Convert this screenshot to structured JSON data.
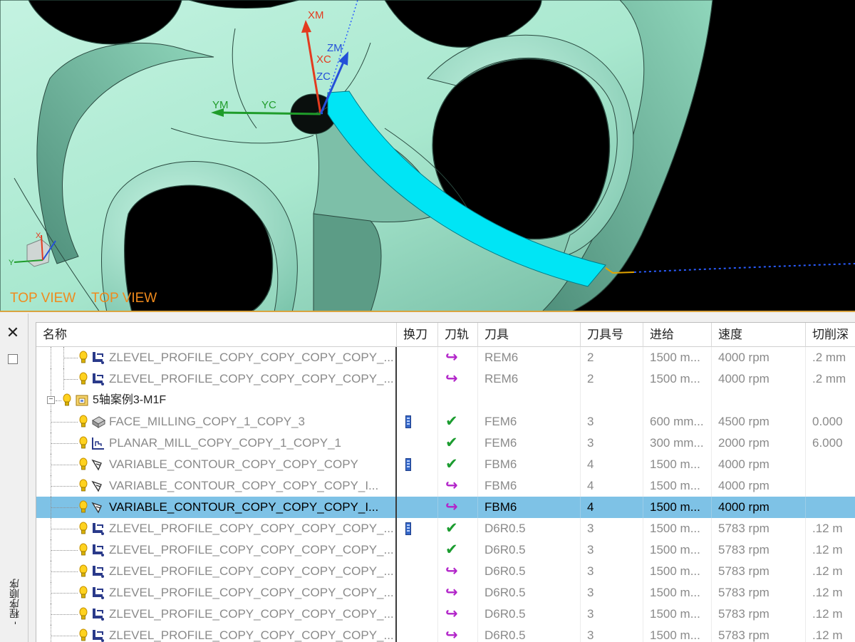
{
  "viewport": {
    "view_labels": [
      "TOP VIEW",
      "TOP VIEW"
    ],
    "axes": {
      "xm": "XM",
      "xc": "XC",
      "zm": "ZM",
      "zc": "ZC",
      "ym": "YM",
      "yc": "YC"
    },
    "triad": {
      "x": "X",
      "y": "Y"
    },
    "colors": {
      "part": "#a9e8cf",
      "highlight": "#00e5f5",
      "background": "#000000",
      "label": "#f08a1c"
    }
  },
  "navigator": {
    "side_label": "- 程序顺序",
    "columns": [
      "名称",
      "换刀",
      "刀轨",
      "刀具",
      "刀具号",
      "进给",
      "速度",
      "切削深"
    ],
    "rows": [
      {
        "indent": 3,
        "type": "zlevel",
        "name": "ZLEVEL_PROFILE_COPY_COPY_COPY_COPY_...",
        "toolchange": false,
        "status": "regen",
        "tool": "REM6",
        "tool_no": "2",
        "feed": "1500 m...",
        "speed": "4000 rpm",
        "cut": ".2 mm"
      },
      {
        "indent": 3,
        "type": "zlevel",
        "name": "ZLEVEL_PROFILE_COPY_COPY_COPY_COPY_...",
        "toolchange": false,
        "status": "regen",
        "tool": "REM6",
        "tool_no": "2",
        "feed": "1500 m...",
        "speed": "4000 rpm",
        "cut": ".2 mm"
      },
      {
        "indent": 1,
        "type": "group",
        "name": "5轴案例3-M1F",
        "toolchange": false,
        "status": "",
        "tool": "",
        "tool_no": "",
        "feed": "",
        "speed": "",
        "cut": ""
      },
      {
        "indent": 2,
        "type": "face",
        "name": "FACE_MILLING_COPY_1_COPY_3",
        "toolchange": true,
        "status": "ok",
        "tool": "FEM6",
        "tool_no": "3",
        "feed": "600 mm...",
        "speed": "4500 rpm",
        "cut": "0.000"
      },
      {
        "indent": 2,
        "type": "planar",
        "name": "PLANAR_MILL_COPY_COPY_1_COPY_1",
        "toolchange": false,
        "status": "ok",
        "tool": "FEM6",
        "tool_no": "3",
        "feed": "300 mm...",
        "speed": "2000 rpm",
        "cut": "6.000"
      },
      {
        "indent": 2,
        "type": "variable",
        "name": "VARIABLE_CONTOUR_COPY_COPY_COPY",
        "toolchange": true,
        "status": "ok",
        "tool": "FBM6",
        "tool_no": "4",
        "feed": "1500 m...",
        "speed": "4000 rpm",
        "cut": ""
      },
      {
        "indent": 2,
        "type": "variable",
        "name": "VARIABLE_CONTOUR_COPY_COPY_COPY_I...",
        "toolchange": false,
        "status": "regen",
        "tool": "FBM6",
        "tool_no": "4",
        "feed": "1500 m...",
        "speed": "4000 rpm",
        "cut": ""
      },
      {
        "indent": 2,
        "type": "variable",
        "name": "VARIABLE_CONTOUR_COPY_COPY_COPY_I...",
        "toolchange": false,
        "status": "regen",
        "tool": "FBM6",
        "tool_no": "4",
        "feed": "1500 m...",
        "speed": "4000 rpm",
        "cut": "",
        "selected": true
      },
      {
        "indent": 2,
        "type": "zlevel",
        "name": "ZLEVEL_PROFILE_COPY_COPY_COPY_COPY_...",
        "toolchange": true,
        "status": "ok",
        "tool": "D6R0.5",
        "tool_no": "3",
        "feed": "1500 m...",
        "speed": "5783 rpm",
        "cut": ".12 m"
      },
      {
        "indent": 2,
        "type": "zlevel",
        "name": "ZLEVEL_PROFILE_COPY_COPY_COPY_COPY_...",
        "toolchange": false,
        "status": "ok",
        "tool": "D6R0.5",
        "tool_no": "3",
        "feed": "1500 m...",
        "speed": "5783 rpm",
        "cut": ".12 m"
      },
      {
        "indent": 2,
        "type": "zlevel",
        "name": "ZLEVEL_PROFILE_COPY_COPY_COPY_COPY_...",
        "toolchange": false,
        "status": "regen",
        "tool": "D6R0.5",
        "tool_no": "3",
        "feed": "1500 m...",
        "speed": "5783 rpm",
        "cut": ".12 m"
      },
      {
        "indent": 2,
        "type": "zlevel",
        "name": "ZLEVEL_PROFILE_COPY_COPY_COPY_COPY_...",
        "toolchange": false,
        "status": "regen",
        "tool": "D6R0.5",
        "tool_no": "3",
        "feed": "1500 m...",
        "speed": "5783 rpm",
        "cut": ".12 m"
      },
      {
        "indent": 2,
        "type": "zlevel",
        "name": "ZLEVEL_PROFILE_COPY_COPY_COPY_COPY_...",
        "toolchange": false,
        "status": "regen",
        "tool": "D6R0.5",
        "tool_no": "3",
        "feed": "1500 m...",
        "speed": "5783 rpm",
        "cut": ".12 m"
      },
      {
        "indent": 2,
        "type": "zlevel",
        "name": "ZLEVEL_PROFILE_COPY_COPY_COPY_COPY_...",
        "toolchange": false,
        "status": "regen",
        "tool": "D6R0.5",
        "tool_no": "3",
        "feed": "1500 m...",
        "speed": "5783 rpm",
        "cut": ".12 m"
      }
    ],
    "status_glyphs": {
      "ok": "✔",
      "regen": "↪"
    }
  }
}
